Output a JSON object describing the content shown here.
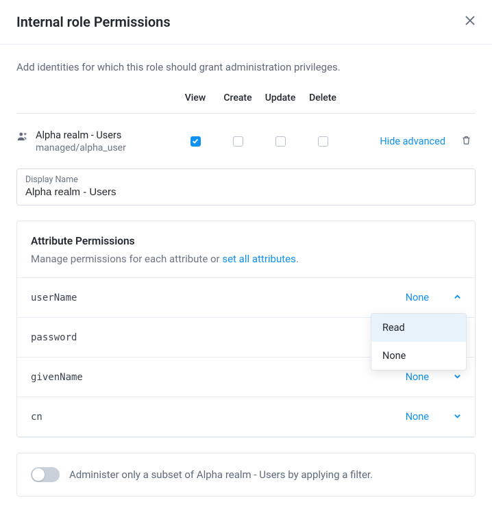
{
  "dialog": {
    "title": "Internal role Permissions",
    "intro": "Add identities for which this role should grant administration privileges."
  },
  "columns": {
    "view": "View",
    "create": "Create",
    "update": "Update",
    "delete": "Delete"
  },
  "identity": {
    "label": "Alpha realm - Users",
    "path": "managed/alpha_user",
    "hide_advanced": "Hide advanced"
  },
  "displayName": {
    "label": "Display Name",
    "value": "Alpha realm - Users"
  },
  "attrPanel": {
    "title": "Attribute Permissions",
    "desc_prefix": "Manage permissions for each attribute or ",
    "set_all": "set all attributes",
    "desc_suffix": "."
  },
  "attrs": [
    {
      "name": "userName",
      "value": "None",
      "open": true
    },
    {
      "name": "password",
      "value": "",
      "open": false
    },
    {
      "name": "givenName",
      "value": "None",
      "open": false
    },
    {
      "name": "cn",
      "value": "None",
      "open": false
    }
  ],
  "dropdown": {
    "options": [
      "Read",
      "None"
    ],
    "selected": "Read"
  },
  "filter": {
    "text": "Administer only a subset of Alpha realm - Users by applying a filter."
  }
}
